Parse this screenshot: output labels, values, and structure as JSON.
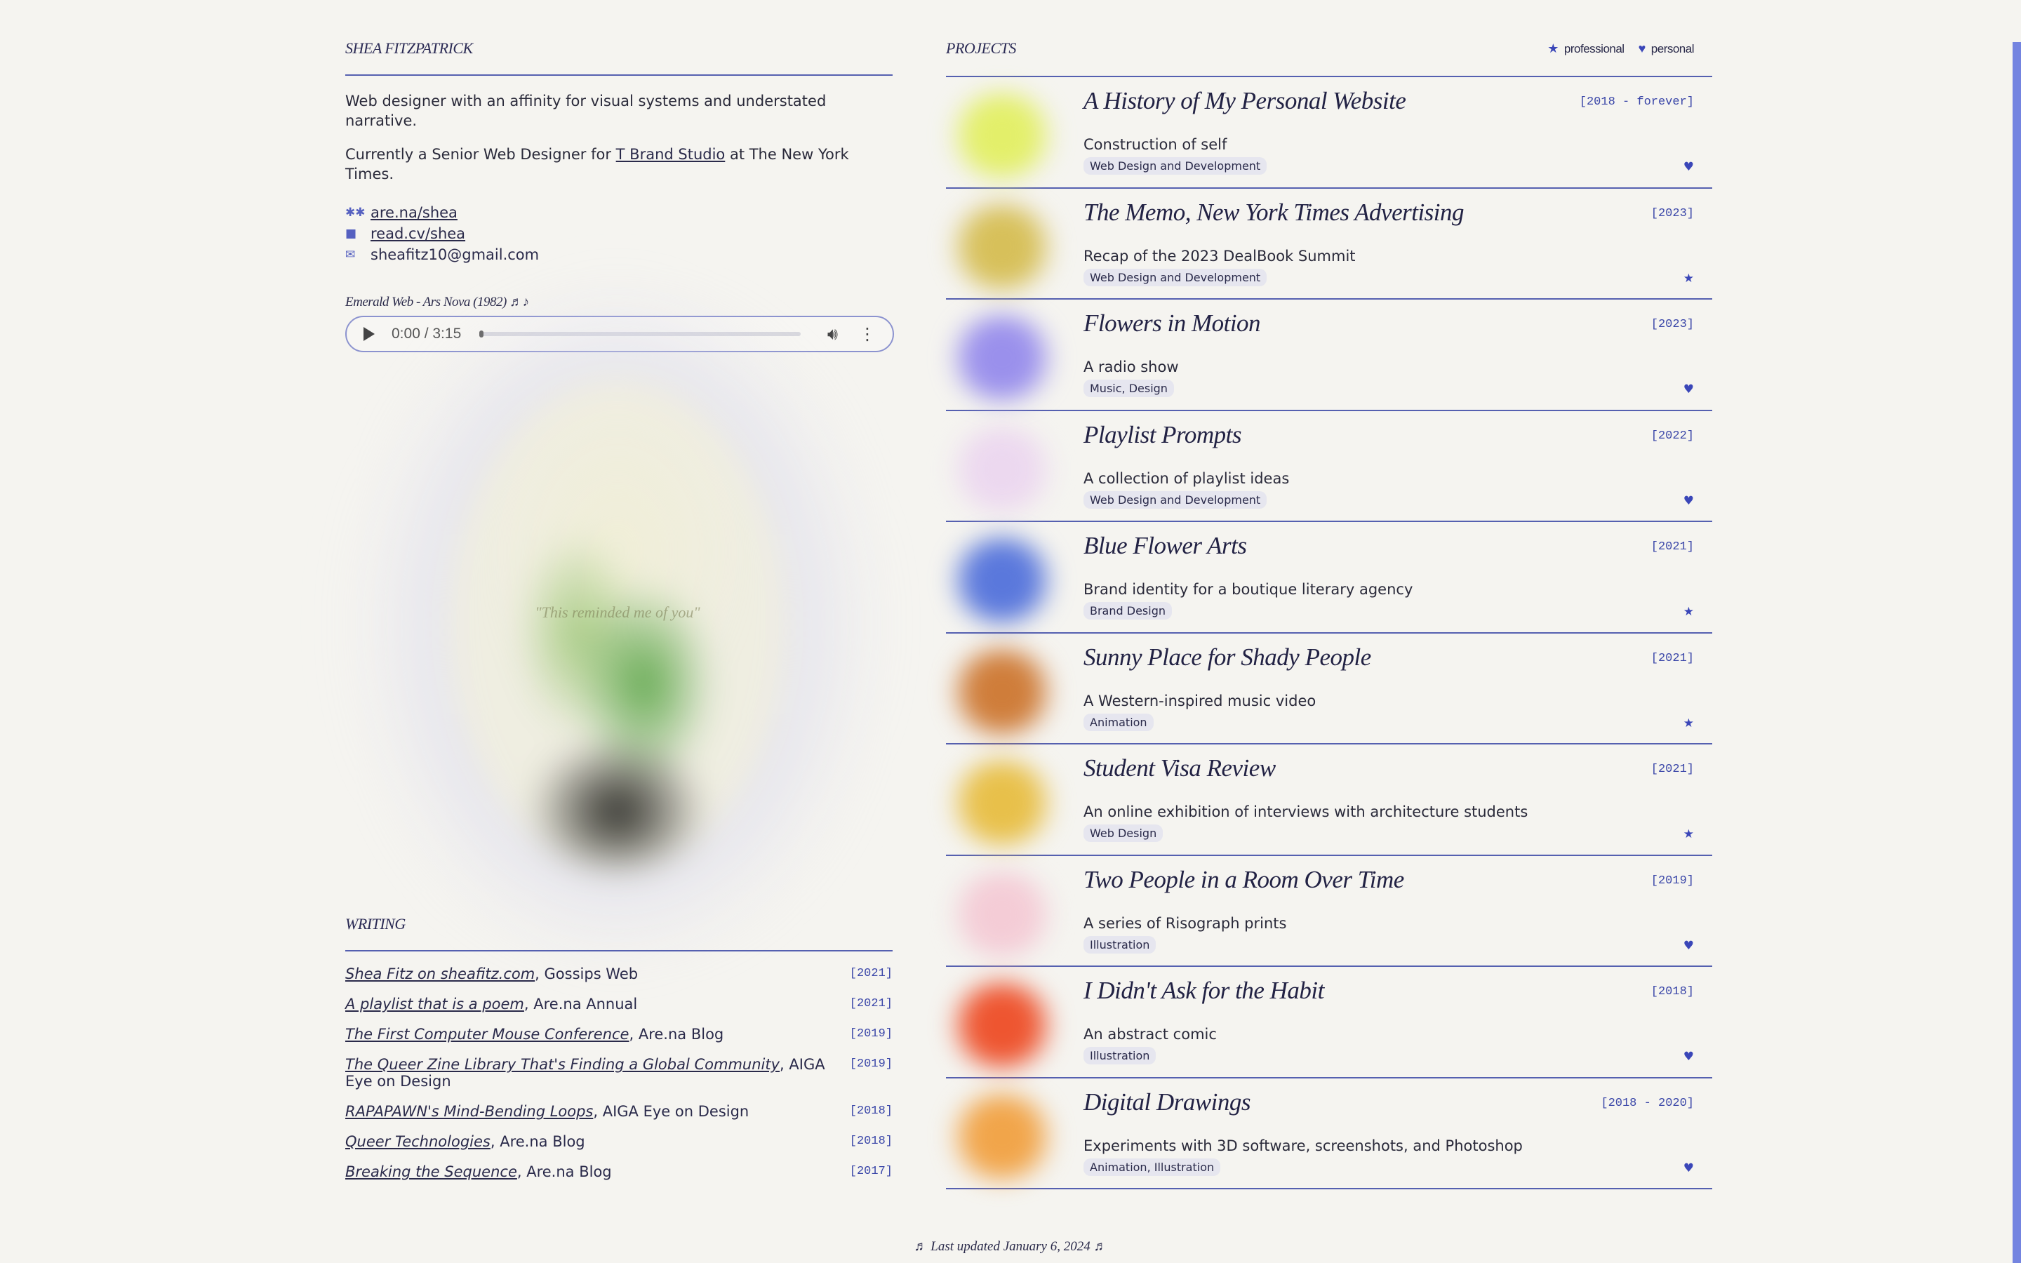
{
  "profile": {
    "name": "SHEA FITZPATRICK",
    "bio_1": "Web designer with an affinity for visual systems and understated narrative.",
    "bio_2_pre": "Currently a Senior Web Designer for ",
    "bio_2_link": "T Brand Studio",
    "bio_2_post": " at The New York Times.",
    "links": [
      {
        "icon": "asterisk-icon",
        "glyph": "✱✱",
        "label": "are.na/shea"
      },
      {
        "icon": "document-icon",
        "glyph": "■",
        "label": "read.cv/shea"
      },
      {
        "icon": "mail-icon",
        "glyph": "✉",
        "label": "sheafitz10@gmail.com"
      }
    ]
  },
  "audio": {
    "label": "Emerald Web - Ars Nova (1982) ♬♪",
    "time": "0:00 / 3:15"
  },
  "art": {
    "quote": "\"This reminded me of you\""
  },
  "writing": {
    "heading": "WRITING",
    "items": [
      {
        "title": "Shea Fitz on sheafitz.com",
        "source": ", Gossips Web",
        "year": "[2021]"
      },
      {
        "title": "A playlist that is a poem",
        "source": ", Are.na Annual",
        "year": "[2021]"
      },
      {
        "title": "The First Computer Mouse Conference",
        "source": ", Are.na Blog",
        "year": "[2019]"
      },
      {
        "title": "The Queer Zine Library That's Finding a Global Community",
        "source": ", AIGA Eye on Design",
        "year": "[2019]"
      },
      {
        "title": "RAPAPAWN's Mind-Bending Loops",
        "source": ", AIGA Eye on Design",
        "year": "[2018]"
      },
      {
        "title": "Queer Technologies",
        "source": ", Are.na Blog",
        "year": "[2018]"
      },
      {
        "title": "Breaking the Sequence",
        "source": ", Are.na Blog",
        "year": "[2017]"
      }
    ]
  },
  "projects": {
    "heading": "PROJECTS",
    "legend_professional": "professional",
    "legend_personal": "personal",
    "items": [
      {
        "title": "A History of My Personal Website",
        "year": "[2018 - forever]",
        "desc": "Construction of self",
        "tag": "Web Design and Development",
        "kind": "personal",
        "color": "#e3ef6a"
      },
      {
        "title": "The Memo, New York Times Advertising",
        "year": "[2023]",
        "desc": "Recap of the 2023 DealBook Summit",
        "tag": "Web Design and Development",
        "kind": "professional",
        "color": "#d7c05a"
      },
      {
        "title": "Flowers in Motion",
        "year": "[2023]",
        "desc": "A radio show",
        "tag": "Music, Design",
        "kind": "personal",
        "color": "#9a90ec"
      },
      {
        "title": "Playlist Prompts",
        "year": "[2022]",
        "desc": "A collection of playlist ideas",
        "tag": "Web Design and Development",
        "kind": "personal",
        "color": "#ecd8ef"
      },
      {
        "title": "Blue Flower Arts",
        "year": "[2021]",
        "desc": "Brand identity for a boutique literary agency",
        "tag": "Brand Design",
        "kind": "professional",
        "color": "#5a78dc"
      },
      {
        "title": "Sunny Place for Shady People",
        "year": "[2021]",
        "desc": "A Western-inspired music video",
        "tag": "Animation",
        "kind": "professional",
        "color": "#cf7d3a"
      },
      {
        "title": "Student Visa Review",
        "year": "[2021]",
        "desc": "An online exhibition of interviews with architecture students",
        "tag": "Web Design",
        "kind": "professional",
        "color": "#e8c04a"
      },
      {
        "title": "Two People in a Room Over Time",
        "year": "[2019]",
        "desc": "A series of Risograph prints",
        "tag": "Illustration",
        "kind": "personal",
        "color": "#f4ccd6"
      },
      {
        "title": "I Didn't Ask for the Habit",
        "year": "[2018]",
        "desc": "An abstract comic",
        "tag": "Illustration",
        "kind": "personal",
        "color": "#ee5530"
      },
      {
        "title": "Digital Drawings",
        "year": "[2018 - 2020]",
        "desc": "Experiments with 3D software, screenshots, and Photoshop",
        "tag": "Animation, Illustration",
        "kind": "personal",
        "color": "#f1a54a"
      }
    ]
  },
  "footer": {
    "text": "♬ Last updated January 6, 2024 ♬"
  }
}
